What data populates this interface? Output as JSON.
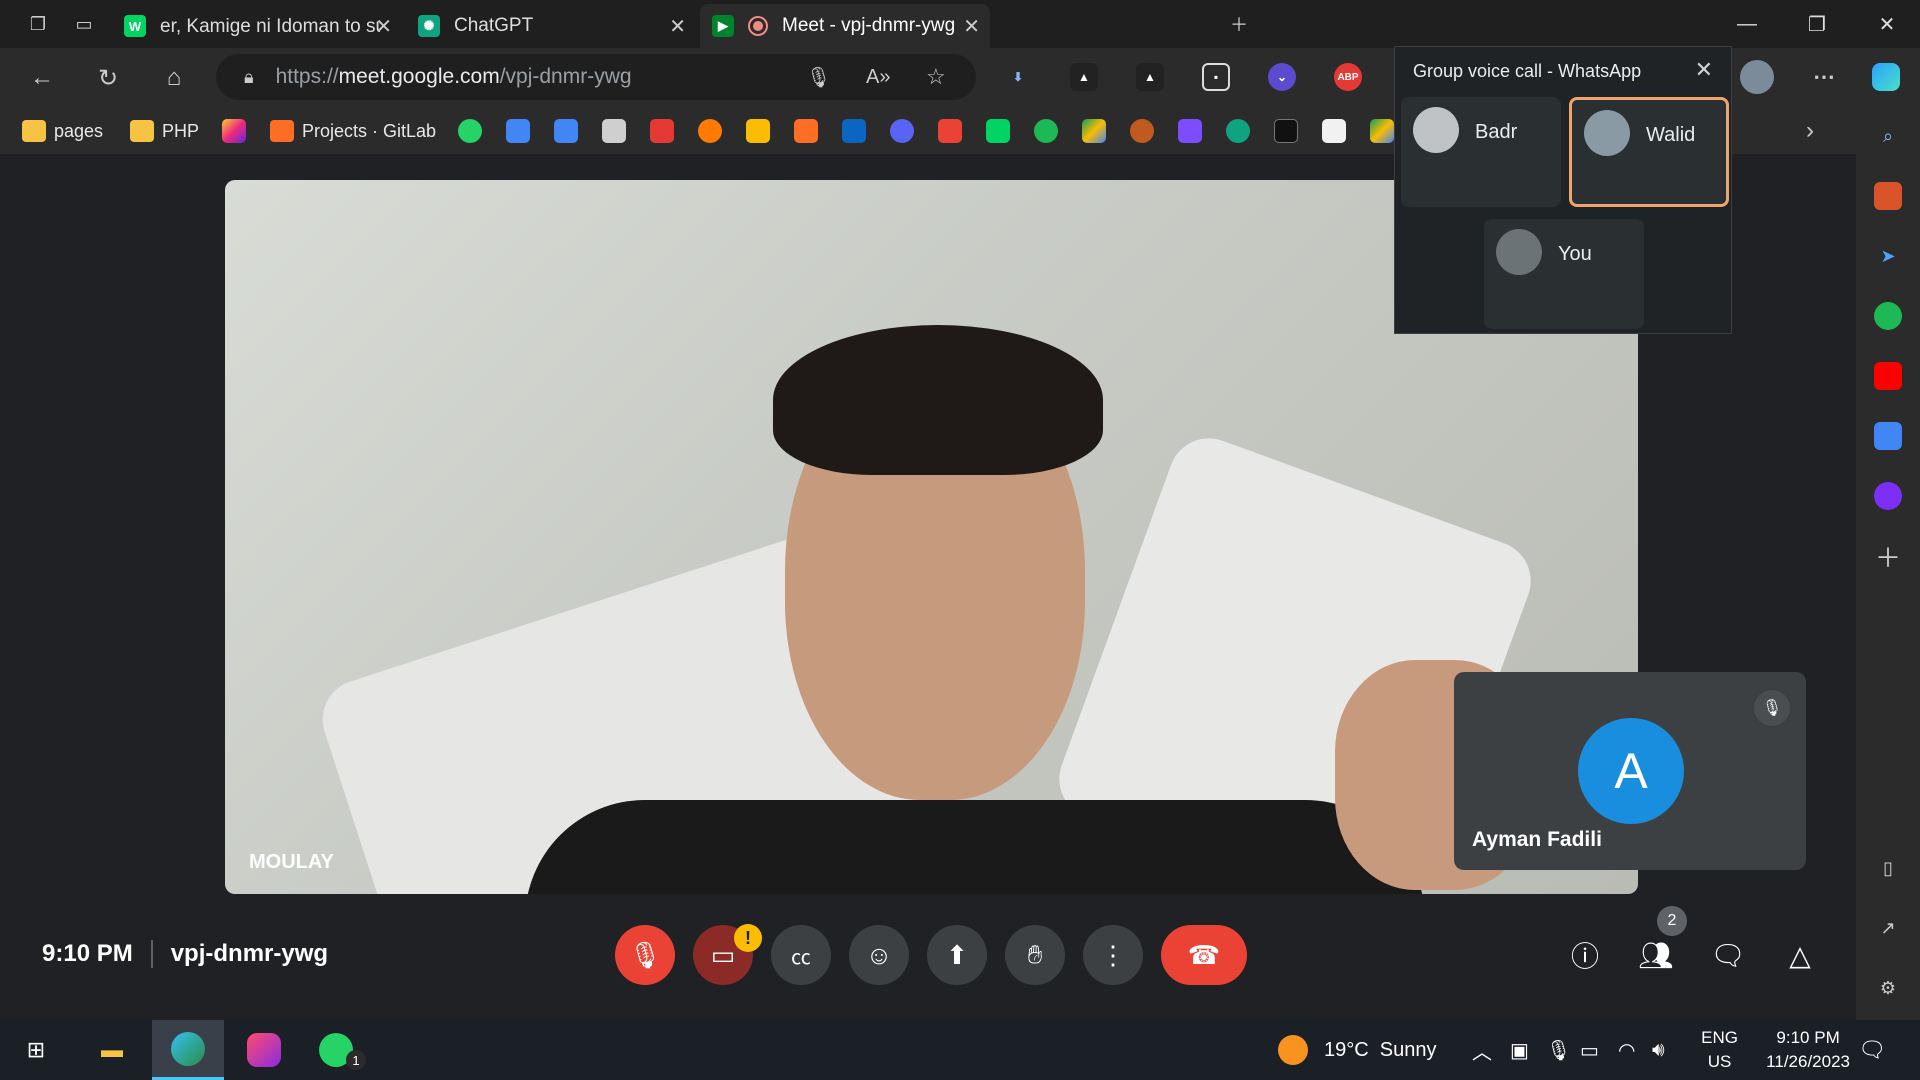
{
  "browser": {
    "tabs": [
      {
        "label": "er, Kamige ni Idoman to su انمي",
        "icon": "webtoon-icon"
      },
      {
        "label": "ChatGPT",
        "icon": "chatgpt-icon"
      },
      {
        "label": "Meet - vpj-dnmr-ywg",
        "icon": "meet-icon"
      }
    ],
    "url_prefix": "https://",
    "url_host": "meet.google.com",
    "url_path": "/vpj-dnmr-ywg",
    "abp_label": "ABP",
    "bookmarks": [
      {
        "label": "pages"
      },
      {
        "label": "PHP"
      },
      {
        "label": "Projects · GitLab"
      }
    ]
  },
  "meet": {
    "main_participant": "MOULAY",
    "self_tile_name": "Ayman Fadili",
    "self_avatar_letter": "A",
    "time": "9:10 PM",
    "meeting_code": "vpj-dnmr-ywg",
    "warning_mark": "!",
    "people_count": "2"
  },
  "whatsapp": {
    "title": "Group voice call - WhatsApp",
    "participants": [
      {
        "name": "Badr"
      },
      {
        "name": "Walid"
      },
      {
        "name": "You"
      }
    ]
  },
  "taskbar": {
    "weather": "19°C  Sunny",
    "lang_top": "ENG",
    "lang_bottom": "US",
    "time": "9:10 PM",
    "date": "11/26/2023",
    "whatsapp_badge": "1"
  },
  "colors": {
    "hangup": "#ea4335",
    "avatar_a": "#1a8ede",
    "wa_active_border": "#f0a36b"
  }
}
